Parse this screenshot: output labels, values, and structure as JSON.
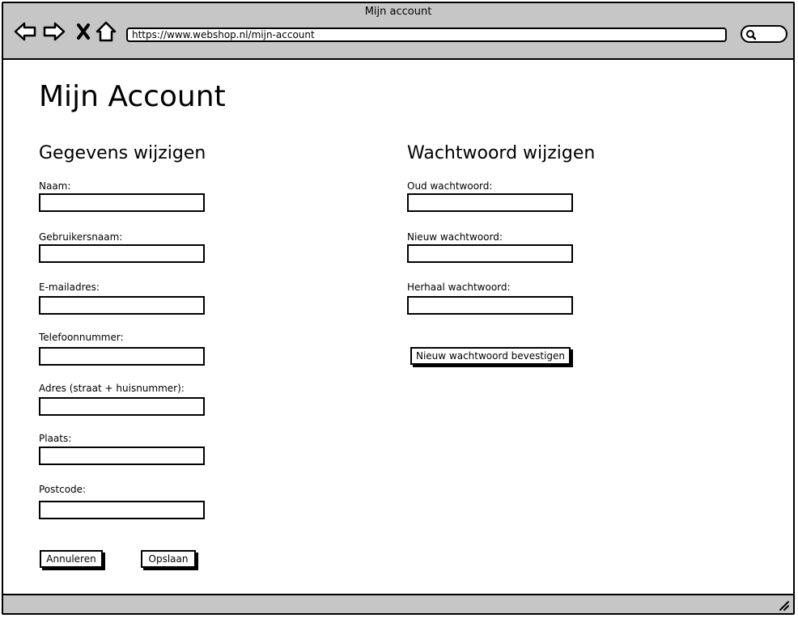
{
  "window": {
    "title": "Mijn account"
  },
  "browser": {
    "url": "https://www.webshop.nl/mijn-account",
    "icons": [
      "back-arrow-icon",
      "forward-arrow-icon",
      "close-icon",
      "home-icon",
      "search-icon"
    ]
  },
  "page": {
    "title": "Mijn Account",
    "left_section": {
      "title": "Gegevens wijzigen",
      "fields": [
        {
          "label": "Naam:",
          "value": ""
        },
        {
          "label": "Gebruikersnaam:",
          "value": ""
        },
        {
          "label": "E-mailadres:",
          "value": ""
        },
        {
          "label": "Telefoonnummer:",
          "value": ""
        },
        {
          "label": "Adres (straat + huisnummer):",
          "value": ""
        },
        {
          "label": "Plaats:",
          "value": ""
        },
        {
          "label": "Postcode:",
          "value": ""
        }
      ],
      "cancel_label": "Annuleren",
      "save_label": "Opslaan"
    },
    "right_section": {
      "title": "Wachtwoord wijzigen",
      "fields": [
        {
          "label": "Oud wachtwoord:",
          "value": ""
        },
        {
          "label": "Nieuw wachtwoord:",
          "value": ""
        },
        {
          "label": "Herhaal wachtwoord:",
          "value": ""
        }
      ],
      "confirm_label": "Nieuw wachtwoord bevestigen"
    }
  },
  "colors": {
    "chrome": "#c6c6c6",
    "border": "#000000",
    "background": "#ffffff"
  }
}
